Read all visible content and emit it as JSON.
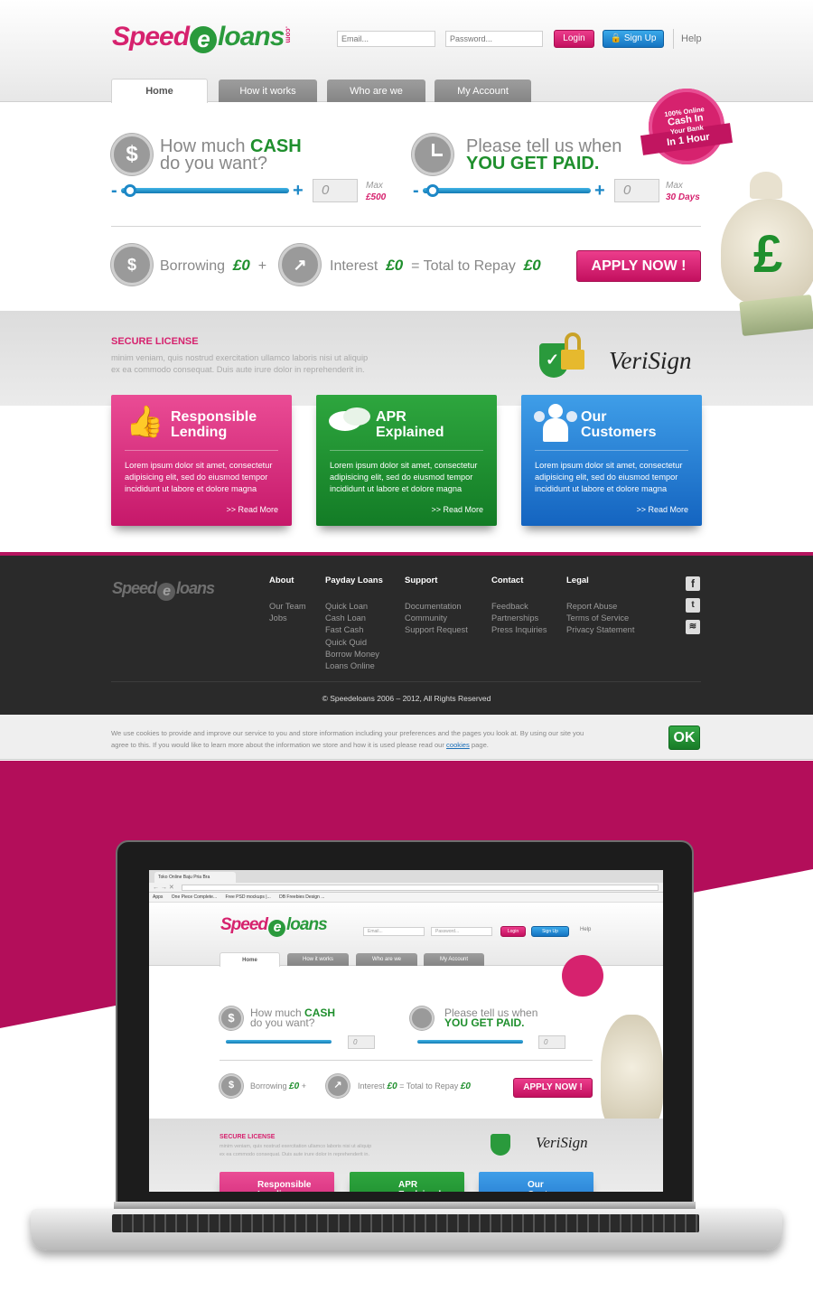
{
  "header": {
    "logo": {
      "speed": "Speed",
      "e": "e",
      "loans": "loans",
      "com": ".com"
    },
    "email_placeholder": "Email...",
    "password_placeholder": "Password...",
    "login": "Login",
    "signup": "Sign Up",
    "help": "Help"
  },
  "tabs": [
    "Home",
    "How it works",
    "Who are we",
    "My Account"
  ],
  "badge": {
    "line1": "100% Online",
    "line2": "Cash In",
    "line3": "Your Bank",
    "line4": "In 1 Hour"
  },
  "calc": {
    "cash": {
      "q1": "How much ",
      "q1b": "CASH",
      "q2": "do you want?",
      "value": "0",
      "max_label": "Max",
      "max_value": "£500",
      "icon": "dollar-icon"
    },
    "paid": {
      "q1": "Please tell us when",
      "q2": "YOU GET PAID.",
      "value": "0",
      "max_label": "Max",
      "max_value": "30 Days",
      "icon": "clock-icon"
    },
    "borrowing_label": "Borrowing",
    "borrowing_value": "£0",
    "plus": "+",
    "interest_label": "Interest",
    "interest_value": "£0",
    "total_label": "= Total to Repay",
    "total_value": "£0",
    "apply": "APPLY NOW !"
  },
  "secure": {
    "title": "SECURE LICENSE",
    "text1": "minim veniam, quis nostrud exercitation ullamco laboris nisi ut aliquip",
    "text2": "ex ea commodo consequat. Duis aute irure dolor in reprehenderit in.",
    "verisign": "VeriSign"
  },
  "cards": [
    {
      "title1": "Responsible",
      "title2": "Lending",
      "text": "Lorem ipsum dolor sit amet, consectetur adipisicing elit, sed do eiusmod tempor incididunt ut labore et dolore magna",
      "more": ">> Read More",
      "icon": "thumbs-up-icon"
    },
    {
      "title1": "APR",
      "title2": "Explained",
      "text": "Lorem ipsum dolor sit amet, consectetur adipisicing elit, sed do eiusmod tempor incididunt ut labore et dolore magna",
      "more": ">> Read More",
      "icon": "speech-bubbles-icon"
    },
    {
      "title1": "Our",
      "title2": "Customers",
      "text": "Lorem ipsum dolor sit amet, consectetur adipisicing elit, sed do eiusmod tempor incididunt ut labore et dolore magna",
      "more": ">> Read More",
      "icon": "people-icon"
    }
  ],
  "footer": {
    "columns": [
      {
        "title": "About",
        "links": [
          "Our Team",
          "Jobs"
        ]
      },
      {
        "title": "Payday Loans",
        "links": [
          "Quick Loan",
          "Cash Loan",
          "Fast Cash",
          "Quick Quid",
          "Borrow Money",
          "Loans Online"
        ]
      },
      {
        "title": "Support",
        "links": [
          "Documentation",
          "Community",
          "Support Request"
        ]
      },
      {
        "title": "Contact",
        "links": [
          "Feedback",
          "Partnerships",
          "Press Inquiries"
        ]
      },
      {
        "title": "Legal",
        "links": [
          "Report Abuse",
          "Terms of Service",
          "Privacy Statement"
        ]
      }
    ],
    "social": [
      "facebook-icon",
      "twitter-icon",
      "rss-icon"
    ],
    "copyright": "© Speedeloans 2006 – 2012, All Rights Reserved"
  },
  "cookie": {
    "text1": "We use cookies to provide and improve our service to you and store information including your preferences and the pages you look at. By using our site you",
    "text2": "agree to this. If you would like to learn more about the information we store and how it is used please read our ",
    "link": "cookies",
    "text3": " page.",
    "ok": "OK"
  },
  "browser": {
    "tab_title": "Toko Online Baju Pria Bra",
    "bookmarks": [
      "Apps",
      "One Piece Complete...",
      "Free PSD mockups |...",
      "DB Freebies Design ..."
    ]
  },
  "colors": {
    "pink": "#d6226e",
    "green": "#1f8f2d",
    "blue": "#1d88c7",
    "footer": "#2a2a2a",
    "magenta_bg": "#b30e5a"
  }
}
